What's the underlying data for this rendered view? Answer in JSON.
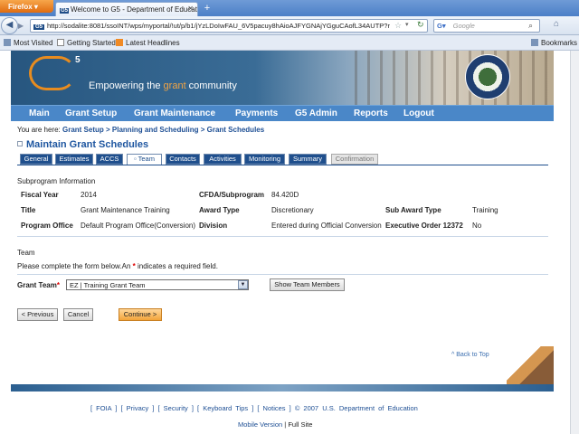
{
  "browser": {
    "app_button": "Firefox",
    "tab_title": "Welcome to G5 - Department of Educati...",
    "tab_favicon": "G5",
    "new_tab": "+",
    "url": "http://sodalite:8081/ssoINT/wps/myportal/!ut/p/b1/jYzLDoIwFAU_6V5pacuy8hAioAJFYGNAjYGguCAofL34AUTP?r",
    "search_placeholder": "Google",
    "bookmarks": [
      "Most Visited",
      "Getting Started",
      "Latest Headlines"
    ],
    "bookmarks_menu": "Bookmarks"
  },
  "banner": {
    "logo_letter": "G",
    "logo_superscript": "5",
    "tagline_pre": "Empowering the ",
    "tagline_highlight": "grant",
    "tagline_post": " community",
    "accent_color": "#e88c1f"
  },
  "menu": [
    "Main",
    "Grant Setup",
    "Grant Maintenance",
    "Payments",
    "G5 Admin",
    "Reports",
    "Logout"
  ],
  "breadcrumb": {
    "prefix": "You are here:",
    "items": [
      "Grant Setup",
      "Planning and Scheduling",
      "Grant Schedules"
    ],
    "separator": ">"
  },
  "page_title": "Maintain Grant Schedules",
  "tabs": [
    "General",
    "Estimates",
    "ACCS",
    "Team",
    "Contacts",
    "Activities",
    "Monitoring",
    "Summary",
    "Confirmation"
  ],
  "subprogram": {
    "heading": "Subprogram Information",
    "fiscal_year_label": "Fiscal Year",
    "fiscal_year": "2014",
    "cfda_label": "CFDA/Subprogram",
    "cfda": "84.420D",
    "title_label": "Title",
    "title": "Grant Maintenance Training",
    "award_type_label": "Award Type",
    "award_type": "Discretionary",
    "sub_award_type_label": "Sub Award Type",
    "sub_award_type": "Training",
    "program_office_label": "Program Office",
    "program_office": "Default Program Office(Conversion)",
    "division_label": "Division",
    "division": "Entered during Official Conversion",
    "exec_order_label": "Executive Order 12372",
    "exec_order": "No"
  },
  "team": {
    "heading": "Team",
    "instructions_pre": "Please complete the form below.An ",
    "required_mark": "*",
    "instructions_post": " indicates a required field.",
    "grant_team_label": "Grant Team",
    "grant_team_value": "EZ | Training Grant Team",
    "show_members_button": "Show Team Members"
  },
  "actions": {
    "previous": "< Previous",
    "cancel": "Cancel",
    "continue": "Continue >"
  },
  "back_to_top": "^ Back to Top",
  "footer": {
    "links": "[ FOIA ]  [ Privacy ]  [ Security ]  [ Keyboard Tips ]  [ Notices ]    ©  2007  U.S.  Department  of  Education",
    "mobile_version": "Mobile Version",
    "mobile_separator": "|",
    "full_site": "Full Site"
  }
}
